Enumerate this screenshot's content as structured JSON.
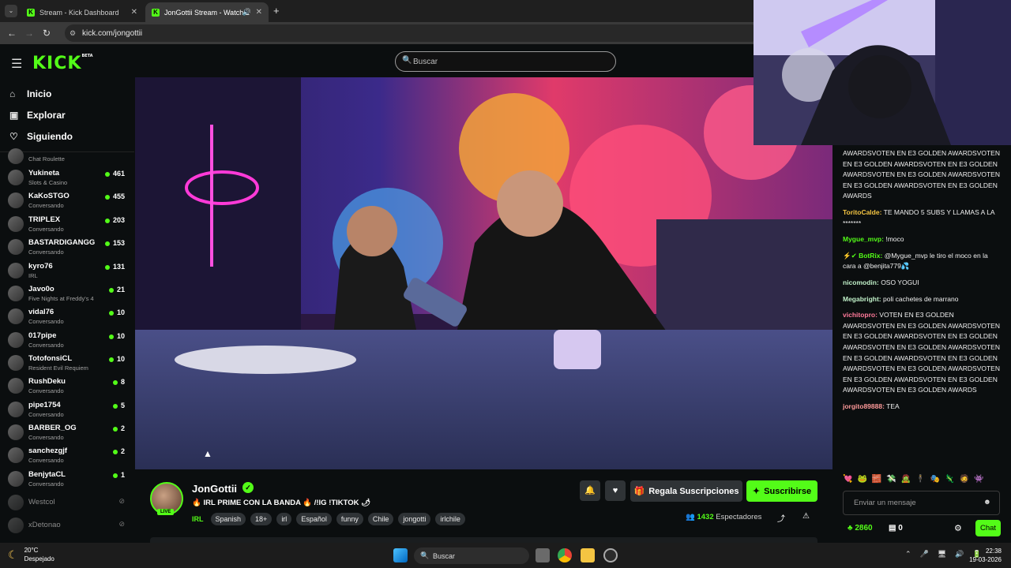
{
  "browser": {
    "tabs": [
      {
        "title": "Stream - Kick Dashboard"
      },
      {
        "title": "JonGottii Stream - Watch L"
      }
    ],
    "new_tab": "+",
    "url": "kick.com/jongottii"
  },
  "header": {
    "logo": "KICK",
    "logo_badge": "BETA",
    "search_placeholder": "Buscar"
  },
  "sidebar": {
    "nav": [
      {
        "label": "Inicio",
        "icon": "home-icon"
      },
      {
        "label": "Explorar",
        "icon": "compass-icon"
      },
      {
        "label": "Siguiendo",
        "icon": "heart-icon"
      }
    ],
    "channels": [
      {
        "name": "",
        "category": "Chat Roulette",
        "viewers": ""
      },
      {
        "name": "Yukineta",
        "category": "Slots & Casino",
        "viewers": "461"
      },
      {
        "name": "KaKoSTGO",
        "category": "Conversando",
        "viewers": "455"
      },
      {
        "name": "TRIPLEX",
        "category": "Conversando",
        "viewers": "203"
      },
      {
        "name": "BASTARDIGANGG",
        "category": "Conversando",
        "viewers": "153"
      },
      {
        "name": "kyro76",
        "category": "IRL",
        "viewers": "131"
      },
      {
        "name": "Javo0o",
        "category": "Five Nights at Freddy's 4",
        "viewers": "21"
      },
      {
        "name": "vidal76",
        "category": "Conversando",
        "viewers": "10"
      },
      {
        "name": "017pipe",
        "category": "Conversando",
        "viewers": "10"
      },
      {
        "name": "TotofonsiCL",
        "category": "Resident Evil Requiem",
        "viewers": "10"
      },
      {
        "name": "RushDeku",
        "category": "Conversando",
        "viewers": "8"
      },
      {
        "name": "pipe1754",
        "category": "Conversando",
        "viewers": "5"
      },
      {
        "name": "BARBER_OG",
        "category": "Conversando",
        "viewers": "2"
      },
      {
        "name": "sanchezgjf",
        "category": "Conversando",
        "viewers": "2"
      },
      {
        "name": "BenjytaCL",
        "category": "Conversando",
        "viewers": "1"
      },
      {
        "name": "Westcol",
        "category": "",
        "viewers": ""
      },
      {
        "name": "xDetonao",
        "category": "",
        "viewers": ""
      }
    ]
  },
  "stream": {
    "streamer": "JonGottii",
    "live_badge": "LIVE",
    "title": "🔥 IRL PRIME CON LA BANDA 🔥 /!IG !TIKTOK 🌶",
    "category": "IRL",
    "tags": [
      "Spanish",
      "18+",
      "irl",
      "Español",
      "funny",
      "Chile",
      "jongotti",
      "irlchile"
    ],
    "gift_label": "Regala Suscripciones",
    "subscribe_label": "Suscribirse",
    "viewers_count": "1432",
    "viewers_label": "Espectadores"
  },
  "chat": {
    "messages": [
      {
        "user": "",
        "text": "AWARDSVOTEN EN E3 GOLDEN AWARDSVOTEN EN E3 GOLDEN AWARDSVOTEN EN E3 GOLDEN AWARDSVOTEN EN E3 GOLDEN AWARDSVOTEN EN E3 GOLDEN AWARDSVOTEN EN E3 GOLDEN AWARDS"
      },
      {
        "user": "ToritoCalde:",
        "text": "TE MANDO 5 SUBS Y LLAMAS A LA *******"
      },
      {
        "user": "Mygue_mvp:",
        "text": "!moco"
      },
      {
        "user": "BotRix:",
        "text": "@Mygue_mvp le tiro el moco en la cara a @benjita779💦"
      },
      {
        "user": "nicomodin:",
        "text": "OSO YOGUI"
      },
      {
        "user": "Megabright:",
        "text": "poli cachetes de marrano"
      },
      {
        "user": "vichitopro:",
        "text": "VOTEN EN E3 GOLDEN AWARDSVOTEN EN E3 GOLDEN AWARDSVOTEN EN E3 GOLDEN AWARDSVOTEN EN E3 GOLDEN AWARDSVOTEN EN E3 GOLDEN AWARDSVOTEN EN E3 GOLDEN AWARDSVOTEN EN E3 GOLDEN AWARDSVOTEN EN E3 GOLDEN AWARDSVOTEN EN E3 GOLDEN AWARDSVOTEN EN E3 GOLDEN AWARDSVOTEN EN E3 GOLDEN AWARDS"
      },
      {
        "user": "jorgito89888:",
        "text": "TEA"
      }
    ],
    "input_placeholder": "Enviar un mensaje",
    "points": "2860",
    "second_count": "0",
    "send_label": "Chat"
  },
  "taskbar": {
    "temperature": "20°C",
    "weather": "Despejado",
    "search": "Buscar",
    "time": "22:38",
    "date": "19-03-2026"
  },
  "colors": {
    "accent": "#53fc18",
    "background": "#0b0e0f"
  }
}
